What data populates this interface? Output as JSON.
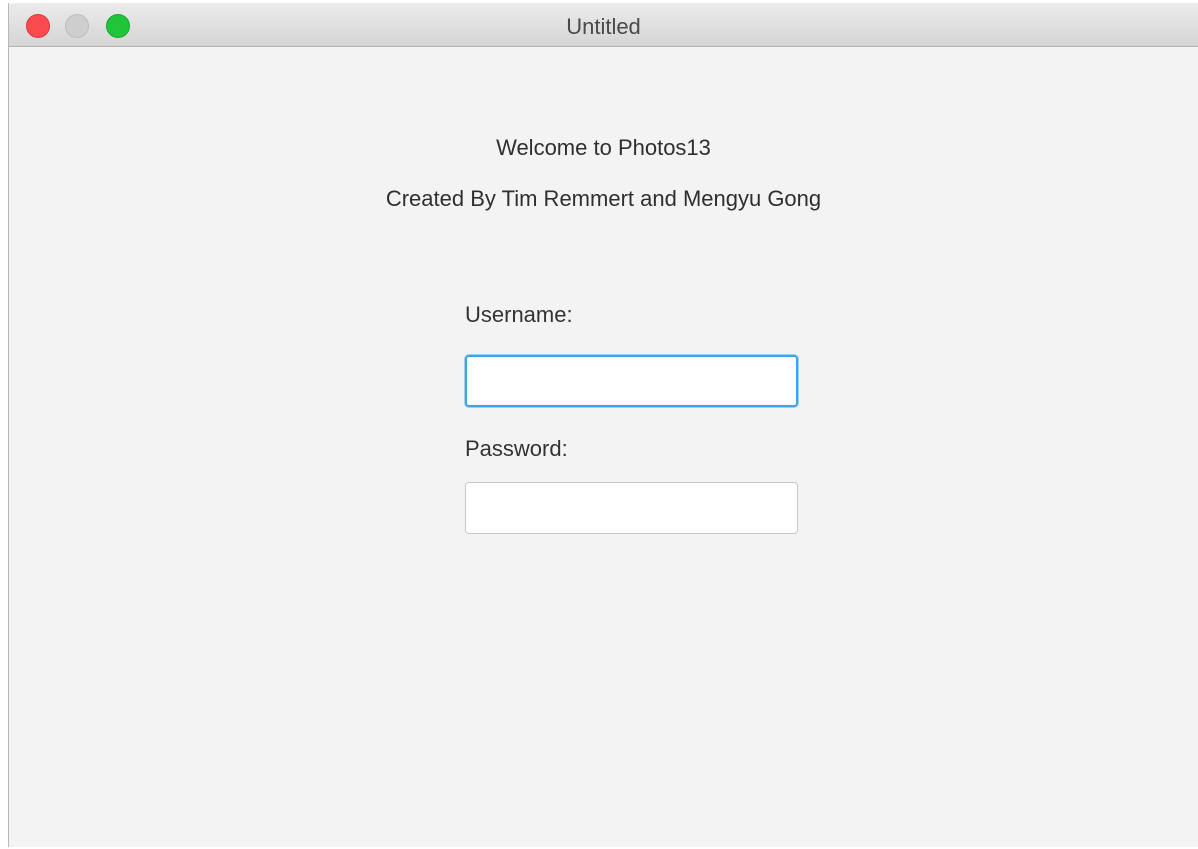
{
  "window": {
    "title": "Untitled"
  },
  "main": {
    "welcome_text": "Welcome to Photos13",
    "credits_text": "Created By Tim Remmert and Mengyu Gong"
  },
  "form": {
    "username_label": "Username:",
    "username_value": "",
    "password_label": "Password:",
    "password_value": ""
  },
  "colors": {
    "close": "#fc4b4e",
    "minimize": "#cecece",
    "zoom": "#20c53a",
    "focus_ring": "#3ea4e6"
  }
}
